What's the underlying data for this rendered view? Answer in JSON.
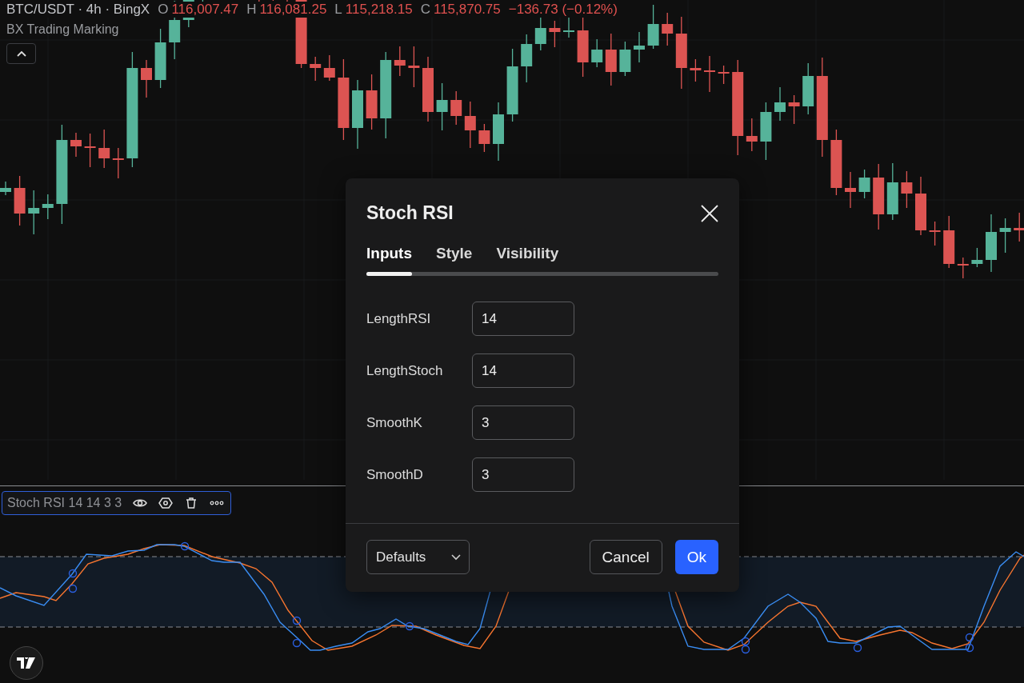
{
  "legend": {
    "symbol": "BTC/USDT · 4h · BingX",
    "ohlc": [
      {
        "label": "O",
        "value": "116,007.47"
      },
      {
        "label": "H",
        "value": "116,081.25"
      },
      {
        "label": "L",
        "value": "115,218.15"
      },
      {
        "label": "C",
        "value": "115,870.75"
      }
    ],
    "change": "−136.73 (−0.12%)",
    "study": "BX Trading Marking",
    "collapsed": false
  },
  "indicator": {
    "label": "Stoch RSI 14 14 3 3",
    "selected": true
  },
  "dialog": {
    "title": "Stoch RSI",
    "tabs": [
      {
        "label": "Inputs",
        "selected": true
      },
      {
        "label": "Style",
        "selected": false
      },
      {
        "label": "Visibility",
        "selected": false
      }
    ],
    "inputs": [
      {
        "label": "LengthRSI",
        "value": "14"
      },
      {
        "label": "LengthStoch",
        "value": "14"
      },
      {
        "label": "SmoothK",
        "value": "3"
      },
      {
        "label": "SmoothD",
        "value": "3"
      }
    ],
    "defaults": "Defaults",
    "cancel": "Cancel",
    "ok": "Ok"
  }
}
